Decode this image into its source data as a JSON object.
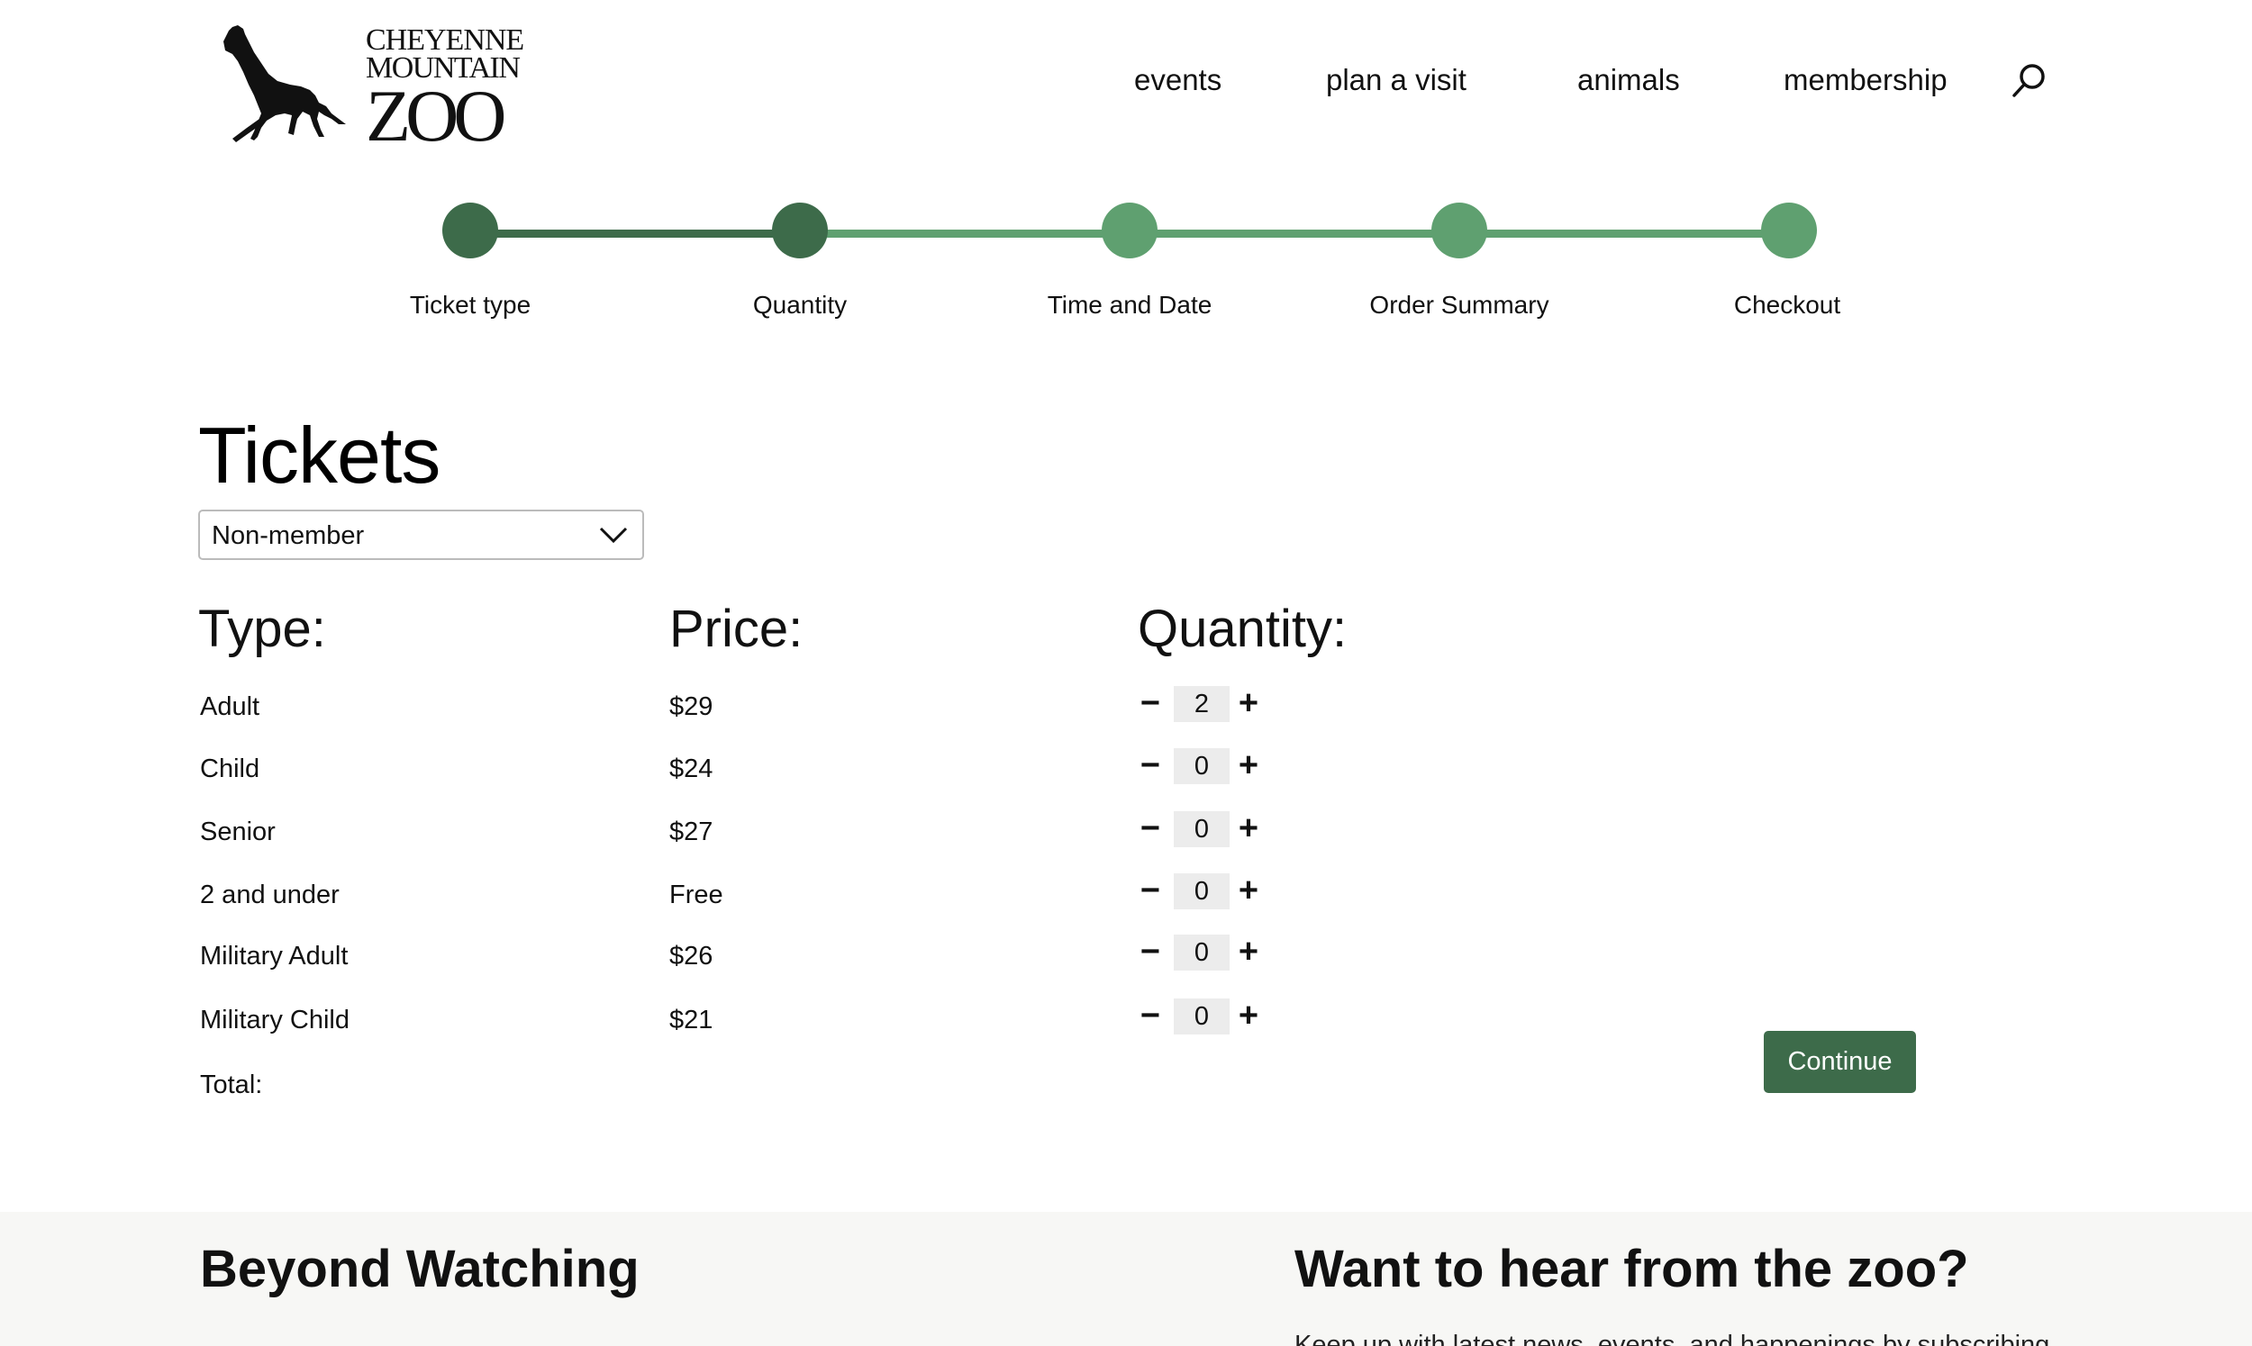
{
  "brand": {
    "line1": "CHEYENNE",
    "line2": "MOUNTAIN",
    "line3": "ZOO"
  },
  "nav": {
    "items": [
      "events",
      "plan a visit",
      "animals",
      "membership"
    ],
    "search_icon": "search-icon"
  },
  "steps": [
    {
      "label": "Ticket type",
      "state": "completed"
    },
    {
      "label": "Quantity",
      "state": "current"
    },
    {
      "label": "Time and Date",
      "state": "upcoming"
    },
    {
      "label": "Order Summary",
      "state": "upcoming"
    },
    {
      "label": "Checkout",
      "state": "upcoming"
    }
  ],
  "colors": {
    "step_dark": "#3d6b4a",
    "step_light": "#5fa070",
    "button": "#3d6b4a",
    "footer_bg": "#f7f7f5"
  },
  "tickets": {
    "title": "Tickets",
    "membership_select": {
      "value": "Non-member",
      "icon": "chevron-down-icon"
    },
    "headers": {
      "type": "Type:",
      "price": "Price:",
      "quantity": "Quantity:"
    },
    "rows": [
      {
        "type": "Adult",
        "price": "$29",
        "quantity": "2"
      },
      {
        "type": "Child",
        "price": "$24",
        "quantity": "0"
      },
      {
        "type": "Senior",
        "price": "$27",
        "quantity": "0"
      },
      {
        "type": "2 and under",
        "price": "Free",
        "quantity": "0"
      },
      {
        "type": "Military Adult",
        "price": "$26",
        "quantity": "0"
      },
      {
        "type": "Military Child",
        "price": "$21",
        "quantity": "0"
      }
    ],
    "minus_symbol": "−",
    "plus_symbol": "+",
    "total_label": "Total:",
    "continue_label": "Continue"
  },
  "footer": {
    "left_heading": "Beyond Watching",
    "right_heading": "Want to hear from the zoo?",
    "right_text": "Keep up with latest news, events, and happenings by subscribing"
  }
}
